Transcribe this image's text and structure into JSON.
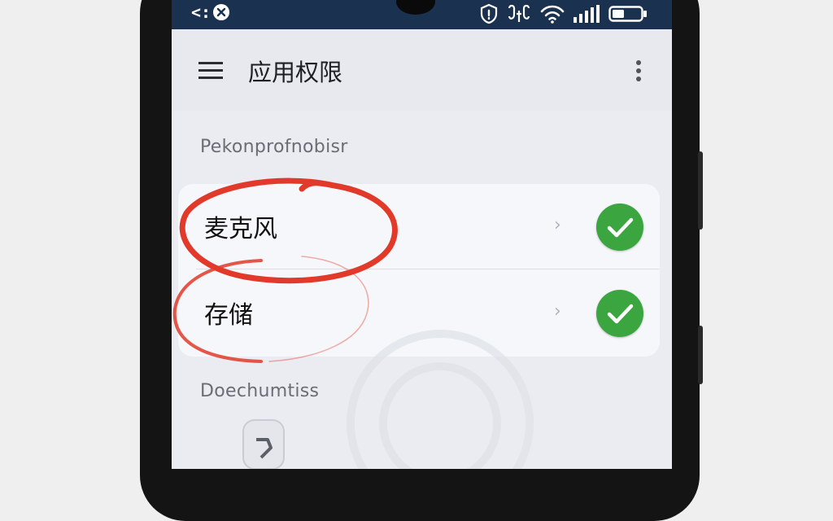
{
  "statusbar": {
    "left_glyph": "<:",
    "icons": [
      "back-nav-icon",
      "close-icon",
      "shield-icon",
      "tty-icon",
      "wifi-icon",
      "signal-icon",
      "battery-icon"
    ]
  },
  "appbar": {
    "title": "应用权限",
    "menu_icon": "hamburger-menu-icon",
    "more_icon": "more-vertical-icon"
  },
  "sections": {
    "first_label": "Pekonprofnobisr",
    "second_label": "Doechumtiss"
  },
  "permissions": [
    {
      "label": "麦克风",
      "chevron": "›",
      "granted": true
    },
    {
      "label": "存储",
      "chevron": "›",
      "granted": true
    }
  ],
  "colors": {
    "statusbar_bg": "#1a3250",
    "check_green": "#3ba53f",
    "annotation_red": "#e23a2a"
  }
}
